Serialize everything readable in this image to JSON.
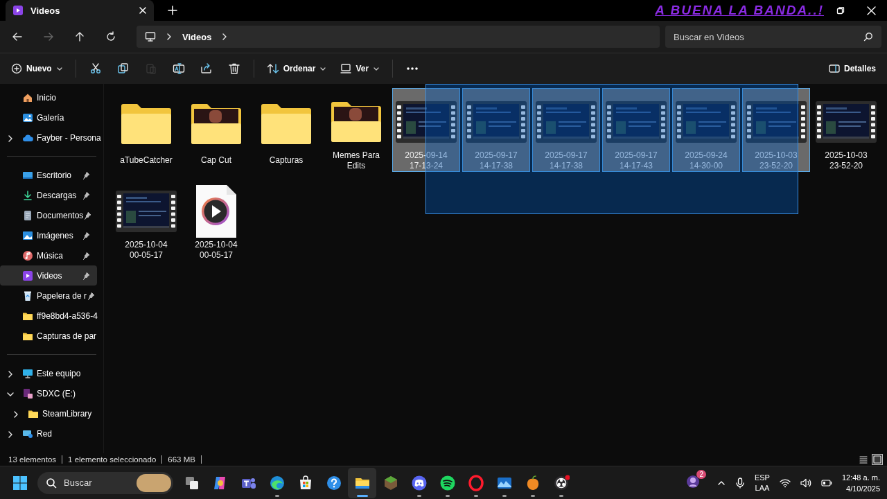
{
  "window": {
    "tab_title": "Videos",
    "overlay_text": "A BUENA LA BANDA..!"
  },
  "navigation": {
    "back_enabled": true,
    "forward_enabled": false,
    "breadcrumb": [
      "Videos"
    ],
    "search": {
      "placeholder": "Buscar en Videos"
    }
  },
  "toolbar": {
    "new_label": "Nuevo",
    "actions": [
      {
        "kind": "cut",
        "disabled": false
      },
      {
        "kind": "copy",
        "disabled": false
      },
      {
        "kind": "paste",
        "disabled": true
      },
      {
        "kind": "rename",
        "disabled": false
      },
      {
        "kind": "share",
        "disabled": false
      },
      {
        "kind": "delete",
        "disabled": false
      }
    ],
    "sort_label": "Ordenar",
    "view_label": "Ver",
    "details_label": "Detalles"
  },
  "sidebar": {
    "groups": [
      [
        {
          "label": "Inicio",
          "pinned": false,
          "selected": false
        },
        {
          "label": "Galería",
          "pinned": false,
          "selected": false
        },
        {
          "label": "Fayber - Persona",
          "pinned": false,
          "selected": false,
          "expanded": false
        }
      ],
      [
        {
          "label": "Escritorio",
          "pinned": true,
          "selected": false
        },
        {
          "label": "Descargas",
          "pinned": true,
          "selected": false
        },
        {
          "label": "Documentos",
          "pinned": true,
          "selected": false
        },
        {
          "label": "Imágenes",
          "pinned": true,
          "selected": false
        },
        {
          "label": "Música",
          "pinned": true,
          "selected": false
        },
        {
          "label": "Videos",
          "pinned": true,
          "selected": true
        },
        {
          "label": "Papelera de r",
          "pinned": true,
          "selected": false
        },
        {
          "label": "ff9e8bd4-a536-4",
          "pinned": false,
          "selected": false
        },
        {
          "label": "Capturas de par",
          "pinned": false,
          "selected": false
        }
      ],
      [
        {
          "label": "Este equipo",
          "pinned": false,
          "selected": false,
          "expanded": false
        },
        {
          "label": "SDXC (E:)",
          "pinned": false,
          "selected": false,
          "expanded": true,
          "children": [
            {
              "label": "SteamLibrary",
              "pinned": false,
              "selected": false,
              "expanded": false
            }
          ]
        },
        {
          "label": "Red",
          "pinned": false,
          "selected": false,
          "expanded": false
        }
      ]
    ]
  },
  "items": [
    {
      "name": "aTubeCatcher",
      "kind": "folder",
      "selected": false
    },
    {
      "name": "Cap Cut",
      "kind": "folder_preview",
      "selected": false
    },
    {
      "name": "Capturas",
      "kind": "folder",
      "selected": false
    },
    {
      "name": "Memes Para Edits",
      "kind": "folder_preview",
      "selected": false
    },
    {
      "name": "2025-09-14 17-13-24",
      "kind": "video",
      "selected": true
    },
    {
      "name": "2025-09-17 14-17-38",
      "kind": "video",
      "selected": true
    },
    {
      "name": "2025-09-17 14-17-38",
      "kind": "video",
      "selected": true
    },
    {
      "name": "2025-09-17 14-17-43",
      "kind": "video",
      "selected": true
    },
    {
      "name": "2025-09-24 14-30-00",
      "kind": "video",
      "selected": true
    },
    {
      "name": "2025-10-03 23-52-20",
      "kind": "video",
      "selected": true
    },
    {
      "name": "2025-10-03 23-52-20",
      "kind": "video",
      "selected": false
    },
    {
      "name": "2025-10-04 00-05-17",
      "kind": "video",
      "selected": false
    },
    {
      "name": "2025-10-04 00-05-17",
      "kind": "media",
      "selected": false
    }
  ],
  "status_bar": {
    "count": "13 elementos",
    "selection": "1 elemento seleccionado",
    "size": "663 MB",
    "views": [
      {
        "selected": false
      },
      {
        "selected": true
      }
    ]
  },
  "taskbar": {
    "search_placeholder": "Buscar",
    "apps": [
      {
        "running": false,
        "active": false,
        "alert": false
      },
      {
        "running": false,
        "active": false,
        "alert": false
      },
      {
        "running": false,
        "active": false,
        "alert": false
      },
      {
        "running": true,
        "active": false,
        "alert": false
      },
      {
        "running": false,
        "active": false,
        "alert": false
      },
      {
        "running": false,
        "active": false,
        "alert": false
      },
      {
        "running": true,
        "active": true,
        "alert": false
      },
      {
        "running": false,
        "active": false,
        "alert": false
      },
      {
        "running": true,
        "active": false,
        "alert": false
      },
      {
        "running": true,
        "active": false,
        "alert": false
      },
      {
        "running": true,
        "active": false,
        "alert": false
      },
      {
        "running": true,
        "active": false,
        "alert": false
      },
      {
        "running": true,
        "active": false,
        "alert": false
      },
      {
        "running": true,
        "active": false,
        "alert": true
      }
    ],
    "notification_badge": "2",
    "language": "ESP",
    "layout": "LAA",
    "time": "12:48 a. m.",
    "date": "4/10/2025"
  }
}
